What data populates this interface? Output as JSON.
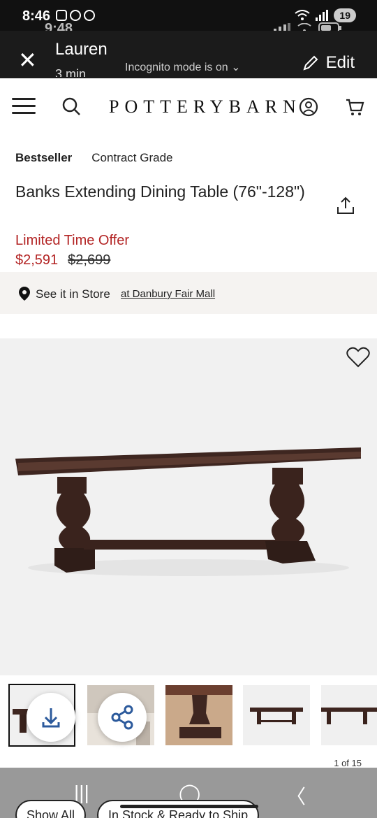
{
  "status_bar": {
    "time": "8:46",
    "battery": "19"
  },
  "ghost_status": {
    "time": "9:48"
  },
  "incognito_bar": {
    "close_label": "✕",
    "name": "Lauren",
    "subtitle": "3 min",
    "mode_text": "Incognito mode is on",
    "edit_label": "Edit"
  },
  "header": {
    "logo": "POTTERYBARN"
  },
  "product": {
    "badges": [
      "Bestseller",
      "Contract Grade"
    ],
    "title": "Banks Extending Dining Table (76\"-128\")",
    "offer": "Limited Time Offer",
    "price_sale": "$2,591",
    "price_was": "$2,699"
  },
  "store": {
    "label": "See it in Store",
    "location": "at Danbury Fair Mall"
  },
  "gallery": {
    "counter": "1 of 15"
  },
  "filters": [
    "Show All",
    "In Stock & Ready to Ship"
  ],
  "colors": {
    "sale_red": "#b32424",
    "wood": "#3e2620"
  }
}
